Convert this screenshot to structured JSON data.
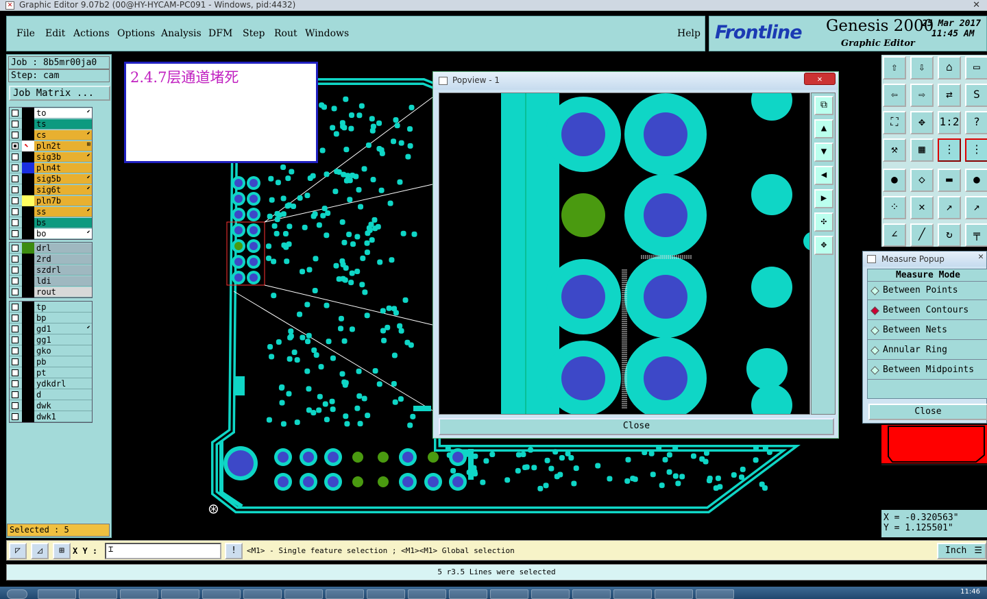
{
  "window": {
    "title": "Graphic Editor 9.07b2 (00@HY-HYCAM-PC091 - Windows, pid:4432)"
  },
  "menu": [
    "File",
    "Edit",
    "Actions",
    "Options",
    "Analysis",
    "DFM",
    "Step",
    "Rout",
    "Windows",
    "Help"
  ],
  "brand": {
    "logo": "Frontline",
    "product": "Genesis 2000",
    "subtitle": "Graphic Editor",
    "date": "25 Mar 2017",
    "time": "11:45 AM"
  },
  "job": {
    "job": "Job : 8b5mr00ja0",
    "step": "Step: cam",
    "matrix_btn": "Job Matrix ..."
  },
  "layers_board": [
    {
      "name": "to",
      "color": "#ffffff",
      "arrow": "⬋"
    },
    {
      "name": "ts",
      "color": "#0d9a80",
      "arrow": ""
    },
    {
      "name": "cs",
      "color": "#e8b030",
      "arrow": "⬋"
    },
    {
      "name": "pln2t",
      "color": "#e8b030",
      "arrow": "⊞"
    },
    {
      "name": "sig3b",
      "color": "#e8b030",
      "arrow": "⬋"
    },
    {
      "name": "pln4t",
      "color": "#e8b030",
      "arrow": ""
    },
    {
      "name": "sig5b",
      "color": "#e8b030",
      "arrow": "⬋"
    },
    {
      "name": "sig6t",
      "color": "#e8b030",
      "arrow": "⬋"
    },
    {
      "name": "pln7b",
      "color": "#e8b030",
      "arrow": ""
    },
    {
      "name": "ss",
      "color": "#e8b030",
      "arrow": "⬋"
    },
    {
      "name": "bs",
      "color": "#0d9a80",
      "arrow": ""
    },
    {
      "name": "bo",
      "color": "#ffffff",
      "arrow": "⬋"
    }
  ],
  "layers_drill": [
    {
      "name": "drl",
      "color": "#9fb8c0"
    },
    {
      "name": "2rd",
      "color": "#9fb8c0"
    },
    {
      "name": "szdrl",
      "color": "#9fb8c0"
    },
    {
      "name": "ldi",
      "color": "#9fb8c0"
    },
    {
      "name": "rout",
      "color": "#d8d8d8"
    }
  ],
  "layers_misc": [
    {
      "name": "tp",
      "arrow": ""
    },
    {
      "name": "bp",
      "arrow": ""
    },
    {
      "name": "gd1",
      "arrow": "⬋"
    },
    {
      "name": "gg1",
      "arrow": ""
    },
    {
      "name": "gko",
      "arrow": ""
    },
    {
      "name": "pb",
      "arrow": ""
    },
    {
      "name": "pt",
      "arrow": ""
    },
    {
      "name": "ydkdrl",
      "arrow": ""
    },
    {
      "name": "d",
      "arrow": ""
    },
    {
      "name": "dwk",
      "arrow": ""
    },
    {
      "name": "dwk1",
      "arrow": ""
    }
  ],
  "selected": "Selected : 5",
  "annotation": "2.4.7层通道堵死",
  "popview": {
    "title": "Popview - 1",
    "close": "Close"
  },
  "measure": {
    "title": "Measure Popup",
    "mode": "Measure Mode",
    "options": [
      "Between Points",
      "Between Contours",
      "Between Nets",
      "Annular Ring",
      "Between Midpoints"
    ],
    "selected_index": 1,
    "close": "Close"
  },
  "coords": {
    "x": "X = -0.320563\"",
    "y": "Y = 1.125501\""
  },
  "cmd": {
    "xy_label": "X Y :",
    "hint": "<M1> - Single feature selection ; <M1><M1> Global selection",
    "units": "Inch"
  },
  "status": "5 r3.5 Lines were selected",
  "taskbar": {
    "clock": "11:46"
  },
  "colors": {
    "pad": "#0fd6c6",
    "hole": "#3d48c8",
    "green": "#4a9a10",
    "panel": "#a3dad9"
  }
}
